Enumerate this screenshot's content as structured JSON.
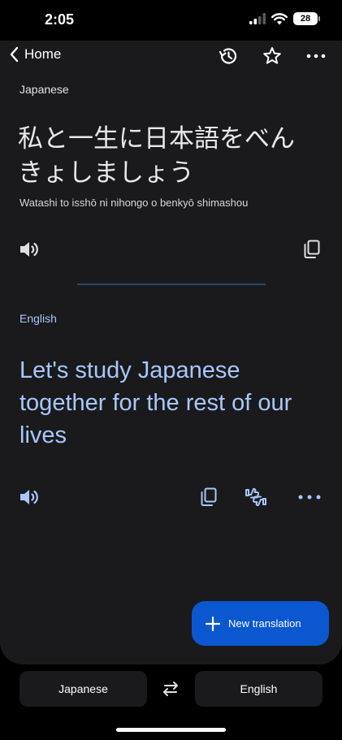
{
  "status_bar": {
    "time": "2:05",
    "battery": "28"
  },
  "nav": {
    "back_label": "Home",
    "icons": [
      "chevron-left-icon",
      "history-icon",
      "star-icon",
      "more-horizontal-icon"
    ]
  },
  "source": {
    "language": "Japanese",
    "text": "私と一生に日本語をべんきょしましょう",
    "romanization": "Watashi to isshō ni nihongo o benkyō shimashou"
  },
  "target": {
    "language": "English",
    "text": "Let's study Japanese together for the rest of our lives"
  },
  "fab": {
    "label": "New translation"
  },
  "bottom_bar": {
    "source_language": "Japanese",
    "target_language": "English"
  },
  "colors": {
    "background": "#000000",
    "card": "#1a1a1c",
    "accent_text": "#a8c7fa",
    "fab": "#0b57d0",
    "divider": "#1f4f6e"
  }
}
